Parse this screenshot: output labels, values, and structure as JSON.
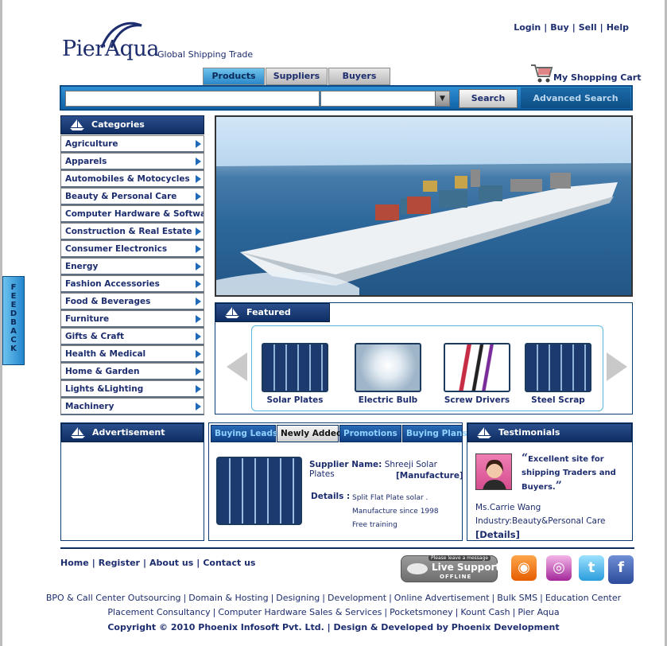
{
  "brand": {
    "name": "PierAqua",
    "tagline": "Global Shipping Trade"
  },
  "top_links": [
    "Login",
    "Buy",
    "Sell",
    "Help"
  ],
  "cart": {
    "label": "My Shopping Cart"
  },
  "main_tabs": [
    {
      "label": "Products",
      "active": true
    },
    {
      "label": "Suppliers",
      "active": false
    },
    {
      "label": "Buyers",
      "active": false
    }
  ],
  "search": {
    "button_label": "Search",
    "advanced_label": "Advanced Search",
    "input_value": "",
    "select_value": ""
  },
  "categories": {
    "title": "Categories",
    "items": [
      "Agriculture",
      "Apparels",
      "Automobiles & Motocycles",
      "Beauty & Personal Care",
      "Computer Hardware & Software",
      "Construction & Real Estate",
      "Consumer Electronics",
      "Energy",
      "Fashion Accessories",
      "Food & Beverages",
      "Furniture",
      "Gifts & Craft",
      "Health & Medical",
      "Home & Garden",
      "Lights &Lighting",
      "Machinery"
    ]
  },
  "feedback": {
    "label": "FEEDBACK"
  },
  "featured": {
    "title": "Featured Products",
    "products": [
      "Solar Plates",
      "Electric Bulb",
      "Screw Drivers",
      "Steel Scrap"
    ]
  },
  "advertisement": {
    "title": "Advertisement"
  },
  "leads": {
    "tabs": [
      {
        "label": "Buying Leads",
        "active": false
      },
      {
        "label": "Newly Added",
        "active": true
      },
      {
        "label": "Promotions",
        "active": false
      },
      {
        "label": "Buying Plans",
        "active": false
      }
    ],
    "supplier_label": "Supplier Name:",
    "supplier_name": "Shreeji Solar Plates",
    "supplier_type": "[Manufacture]",
    "details_label": "Details :",
    "details_lines": [
      "Split Flat Plate solar .",
      "Manufacture since 1998",
      "Free training"
    ]
  },
  "testimonials": {
    "title": "Testimonials",
    "quote": "Excellent site for shipping Traders and Buyers.",
    "name": "Ms.Carrie Wang",
    "industry": "Industry:Beauty&Personal Care",
    "details_link": "[Details]"
  },
  "footer": {
    "links": [
      "Home",
      "Register",
      "About us",
      "Contact us"
    ],
    "live_support": {
      "message": "Please leave a message",
      "title": "Live Support",
      "status": "OFFLINE"
    },
    "social": [
      "rss-icon",
      "instagram-icon",
      "twitter-icon",
      "facebook-icon"
    ],
    "services_line1": [
      "BPO & Call Center Outsourcing",
      "Domain & Hosting",
      "Designing",
      "Development",
      "Online Advertisement",
      "Bulk SMS",
      "Education Center"
    ],
    "services_line2": [
      "Placement Consultancy",
      "Computer Hardware Sales & Services",
      "Pocketsmoney",
      "Kount Cash",
      "Pier Aqua"
    ],
    "copyright": "Copyright © 2010 Phoenix Infosoft Pvt. Ltd. | Design & Developed by Phoenix Development"
  }
}
